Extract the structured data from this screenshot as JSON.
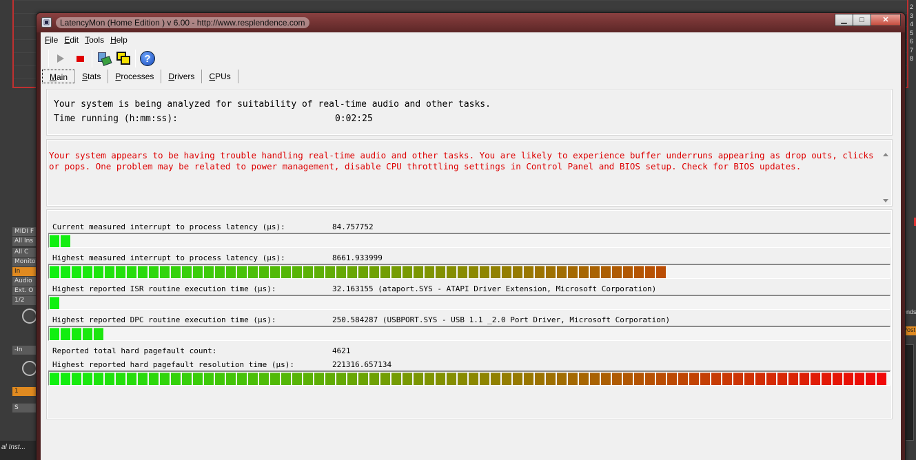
{
  "background": {
    "bottom_text": "al Inst...",
    "track_numbers": [
      "2",
      "3",
      "4",
      "5",
      "6",
      "7",
      "8"
    ],
    "left_tags": [
      "MIDI F",
      "All Ins",
      "All C",
      "Monito",
      "In",
      "Audio",
      "Ext. O",
      "1/2",
      "-In",
      "1",
      "S"
    ],
    "right_labels": [
      "ends",
      "Post"
    ]
  },
  "window": {
    "title": "LatencyMon  (Home Edition )  v 6.00 - http://www.resplendence.com",
    "caption": {
      "minimize": "▁",
      "maximize": "□",
      "close": "✕"
    }
  },
  "menu": {
    "file_u": "F",
    "file_rest": "ile",
    "edit_u": "E",
    "edit_rest": "dit",
    "tools_u": "T",
    "tools_rest": "ools",
    "help_u": "H",
    "help_rest": "elp"
  },
  "toolbar": {
    "icons": [
      "play-icon",
      "stop-icon",
      "tools-icon",
      "windows-icon",
      "help-icon"
    ],
    "help_glyph": "?"
  },
  "tabs": {
    "main_u": "M",
    "main_rest": "ain",
    "stats_u": "S",
    "stats_rest": "tats",
    "processes_u": "P",
    "processes_rest": "rocesses",
    "drivers_u": "D",
    "drivers_rest": "rivers",
    "cpus_u": "C",
    "cpus_rest": "PUs"
  },
  "main": {
    "status_line": "Your system is being analyzed for suitability of real-time audio and other tasks.",
    "time_label": "Time running (h:mm:ss):",
    "time_value": "0:02:25",
    "warning": "Your system appears to be having trouble handling real-time audio and other tasks. You are likely to experience buffer underruns appearing as drop outs, clicks or pops. One problem may be related to power management, disable CPU throttling settings in Control Panel and BIOS setup. Check for BIOS updates."
  },
  "metrics": {
    "current_latency": {
      "label": "Current measured interrupt to process latency (µs):",
      "value": "84.757752",
      "fill": 0.025
    },
    "highest_latency": {
      "label": "Highest measured interrupt to process latency (µs):",
      "value": "8661.933999",
      "fill": 0.735
    },
    "isr_time": {
      "label": "Highest reported ISR routine execution time (µs):",
      "value": "32.163155  (ataport.SYS - ATAPI Driver Extension, Microsoft Corporation)",
      "fill": 0.012
    },
    "dpc_time": {
      "label": "Highest reported DPC routine execution time (µs):",
      "value": "250.584287  (USBPORT.SYS - USB 1.1 _2.0 Port Driver, Microsoft Corporation)",
      "fill": 0.065
    },
    "pagefault_count": {
      "label": "Reported total hard pagefault count:",
      "value": "4621"
    },
    "pagefault_time": {
      "label": "Highest reported hard pagefault resolution time (µs):",
      "value": "221316.657134",
      "fill": 1.0
    }
  },
  "colors": {
    "bar_start": "#10f010",
    "bar_mid": "#8a8a00",
    "bar_end": "#f00808",
    "warning_text": "#dd0000"
  }
}
